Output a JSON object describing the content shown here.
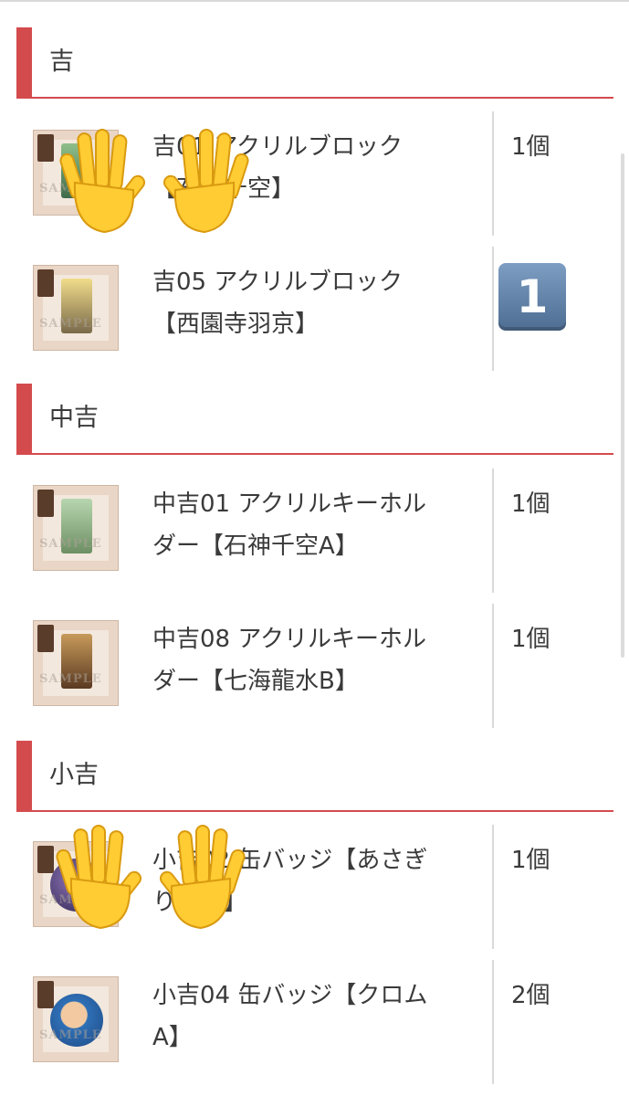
{
  "sections": [
    {
      "title": "吉",
      "items": [
        {
          "name": "吉01 アクリルブロック\n【石神千空】",
          "quantity": "1個"
        },
        {
          "name": "吉05 アクリルブロック\n【西園寺羽京】",
          "quantity": "1"
        }
      ]
    },
    {
      "title": "中吉",
      "items": [
        {
          "name": "中吉01 アクリルキーホル\nダー【石神千空A】",
          "quantity": "1個"
        },
        {
          "name": "中吉08 アクリルキーホル\nダー【七海龍水B】",
          "quantity": "1個"
        }
      ]
    },
    {
      "title": "小吉",
      "items": [
        {
          "name": "小吉02 缶バッジ【あさぎ\nりゲン】",
          "quantity": "1個"
        },
        {
          "name": "小吉04 缶バッジ【クロム\nA】",
          "quantity": "2個"
        }
      ]
    }
  ],
  "thumbnail_watermark": "SAMPLE",
  "colors": {
    "accent": "#d44b4e",
    "divider": "#d9d9d9",
    "text": "#3a3a3a",
    "thumb_bg": "#ead6c6",
    "keycap": "#5e7fa6"
  },
  "icons": [
    "raised-hand-emoji-icon",
    "keycap-one-emoji-icon"
  ]
}
